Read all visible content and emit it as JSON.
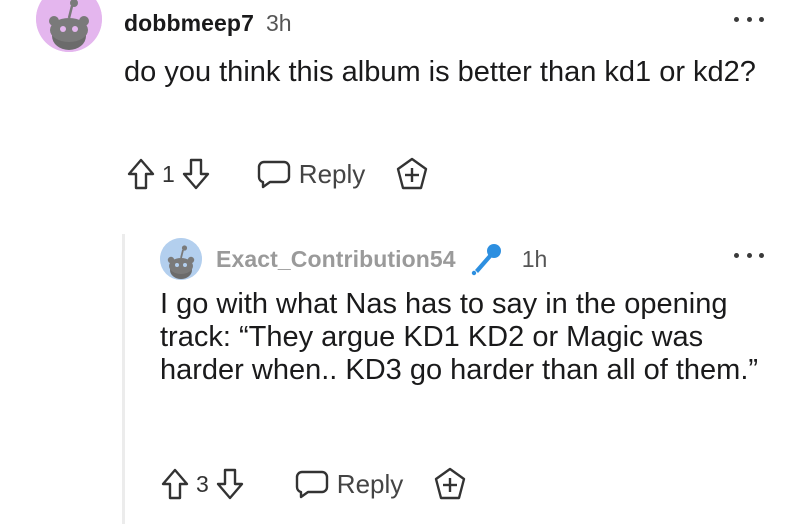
{
  "comment": {
    "username": "dobbmeep7",
    "time": "3h",
    "body": "do you think this album is better than kd1 or kd2?",
    "votes": "1",
    "reply_label": "Reply",
    "avatar_color": "#e4b6ee",
    "icons": [
      "snoo-avatar",
      "more-options-icon",
      "upvote-icon",
      "downvote-icon",
      "reply-icon",
      "award-icon"
    ]
  },
  "reply": {
    "username": "Exact_Contribution54",
    "time": "1h",
    "body": "I go with what Nas has to say in the opening track: “They argue KD1 KD2 or Magic was harder when.. KD3 go harder than all of them.”",
    "votes": "3",
    "reply_label": "Reply",
    "avatar_color": "#b3cfee",
    "flair_icon": "microphone-icon",
    "flair_color": "#2d8fe0",
    "icons": [
      "snoo-avatar",
      "microphone-icon",
      "more-options-icon",
      "upvote-icon",
      "downvote-icon",
      "reply-icon",
      "award-icon"
    ]
  }
}
